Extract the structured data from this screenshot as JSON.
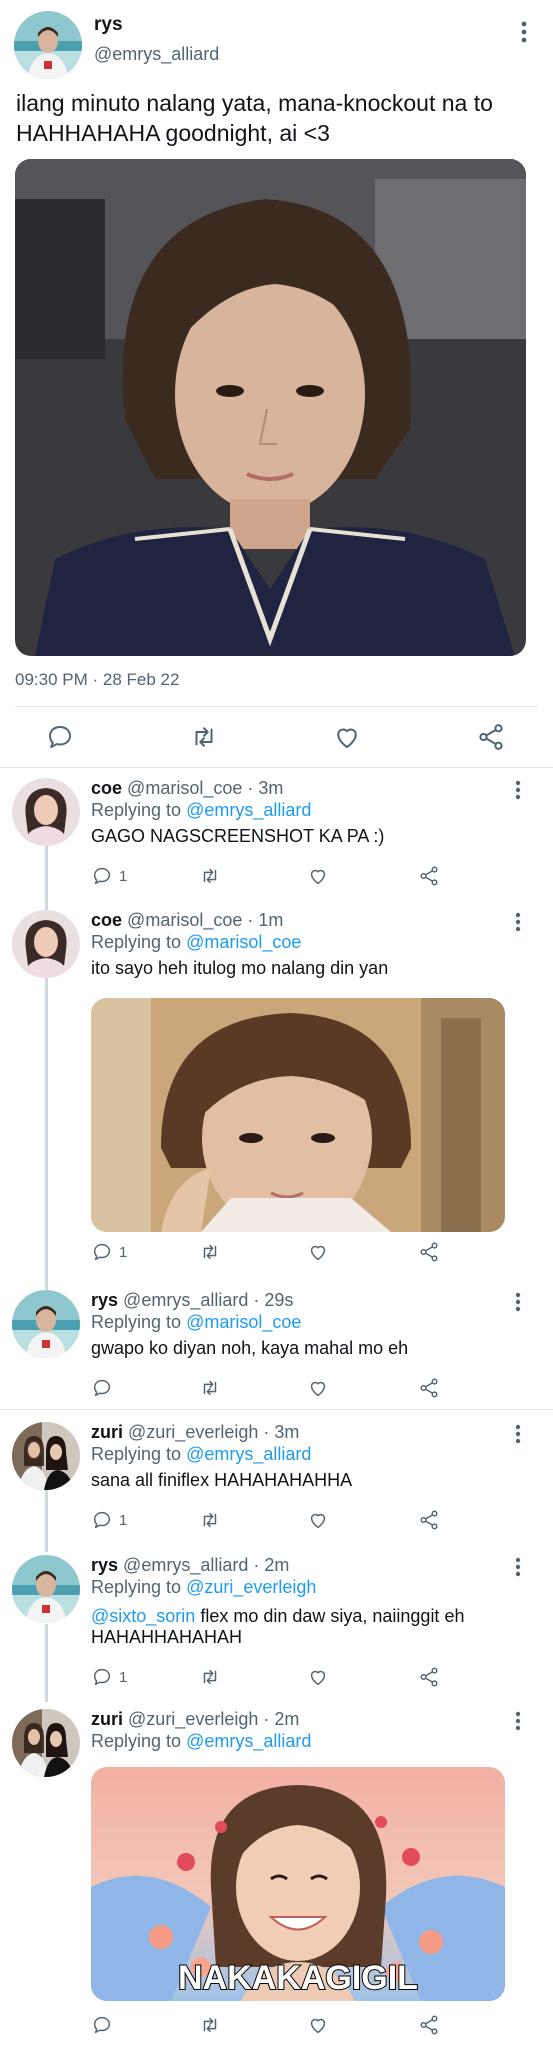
{
  "main_tweet": {
    "name": "rys",
    "handle": "@emrys_alliard",
    "text": "ilang minuto nalang yata, mana-knockout na to HAHHAHAHA goodnight, ai <3",
    "timestamp": "09:30 PM · 28 Feb 22",
    "actions": [
      "reply-icon",
      "retweet-icon",
      "like-icon",
      "share-icon"
    ]
  },
  "replies": [
    {
      "name": "coe",
      "handle": "@marisol_coe",
      "time": "3m",
      "replying_prefix": "Replying to",
      "replying_to": "@emrys_alliard",
      "text": "GAGO NAGSCREENSHOT KA PA :)",
      "reply_count": "1"
    },
    {
      "name": "coe",
      "handle": "@marisol_coe",
      "time": "1m",
      "replying_prefix": "Replying to",
      "replying_to": "@marisol_coe",
      "text": "ito sayo heh itulog mo nalang din yan",
      "reply_count": "1"
    },
    {
      "name": "rys",
      "handle": "@emrys_alliard",
      "time": "29s",
      "replying_prefix": "Replying to",
      "replying_to": "@marisol_coe",
      "text": "gwapo ko diyan noh, kaya mahal mo eh",
      "reply_count": ""
    },
    {
      "name": "zuri",
      "handle": "@zuri_everleigh",
      "time": "3m",
      "replying_prefix": "Replying to",
      "replying_to": "@emrys_alliard",
      "text": "sana all finiflex HAHAHAHAHHA",
      "reply_count": "1"
    },
    {
      "name": "rys",
      "handle": "@emrys_alliard",
      "time": "2m",
      "replying_prefix": "Replying to",
      "replying_to": "@zuri_everleigh",
      "mention": "@sixto_sorin",
      "text_line1": " flex mo din daw siya, naiinggit eh",
      "text_line2": "HAHAHHAHAHAH",
      "reply_count": "1"
    },
    {
      "name": "zuri",
      "handle": "@zuri_everleigh",
      "time": "2m",
      "replying_prefix": "Replying to",
      "replying_to": "@emrys_alliard",
      "media_caption": "NAKAKAGIGIL",
      "reply_count": ""
    }
  ],
  "colors": {
    "text": "#0f1419",
    "secondary": "#536471",
    "link": "#1d9bf0",
    "divider": "#e4e8eb",
    "thread_line": "#cfd9de"
  }
}
